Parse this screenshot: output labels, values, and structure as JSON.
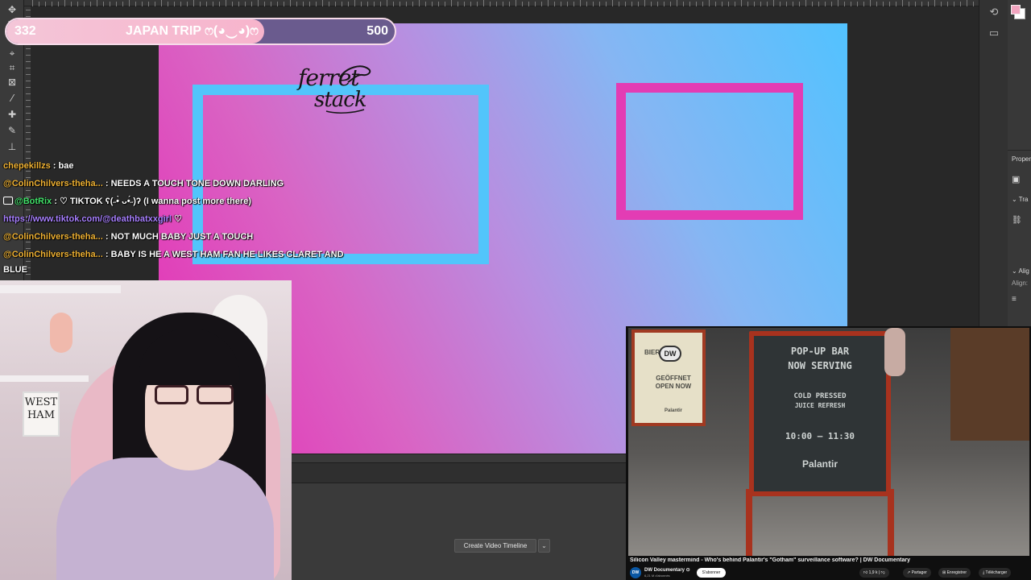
{
  "goal": {
    "current": "332",
    "title": "JAPAN TRIP ෆ(◕‿◕)ෆ",
    "target": "500",
    "progress_fraction": 0.664,
    "colors": {
      "fill": "#f4c6d8",
      "track": "#6a5b8e",
      "border": "#f6dbe9"
    }
  },
  "canvas": {
    "logo_line1": "ferret",
    "logo_line2": "stack",
    "frame_colors": {
      "blue": "#52c5fb",
      "pink": "#e33cb4"
    }
  },
  "chat": {
    "messages": [
      {
        "user": "chepekillzs",
        "text": " : bae"
      },
      {
        "user": "@ColinChilvers-theha...",
        "text": " : NEEDS A TOUCH TONE DOWN DARLING"
      },
      {
        "user": "@BotRix",
        "text": " : ♡ TIKTOK ʕ(˶•̀ ᴗ•́˶)ʔ (I wanna post more there)"
      },
      {
        "link": "https://www.tiktok.com/@deathbatxxgirl",
        "text": " ♡"
      },
      {
        "user": "@ColinChilvers-theha...",
        "text": " : NOT MUCH BABY JUST A TOUCH"
      },
      {
        "user": "@ColinChilvers-theha...",
        "text": " : BABY IS HE A WEST HAM FAN HE LIKES CLARET AND"
      },
      {
        "text": "BLUE"
      }
    ]
  },
  "webcam": {
    "sign_line1": "WEST",
    "sign_line2": "HAM"
  },
  "photoshop": {
    "timeline_button": "Create Video Timeline",
    "timeline_dropdown": "⌄",
    "panels": {
      "properties": "Proper",
      "transform": "Tra",
      "align": "Alig",
      "align_sub": "Align:"
    }
  },
  "youtube": {
    "title": "Silicon Valley mastermind - Who's behind Palantir's \"Gotham\" surveillance software? | DW Documentary",
    "channel": "DW Documentary ⊙",
    "subscribers": "6,21 M d'abonnés",
    "subscribe": "S'abonner",
    "likes": "1,9 k",
    "share": "Partager",
    "save": "Enregistrer",
    "download": "Télécharger",
    "board": {
      "line1": "POP-UP BAR",
      "line2": "NOW SERVING",
      "line3": "COLD PRESSED",
      "line4": "JUICE REFRESH",
      "line5": "10:00 — 11:30",
      "line6": "Palantir"
    },
    "left_board": {
      "line1": "BIER",
      "line2": "GEÖFFNET",
      "line3": "OPEN NOW",
      "line4": "Palantir"
    },
    "dw_logo": "DW"
  }
}
